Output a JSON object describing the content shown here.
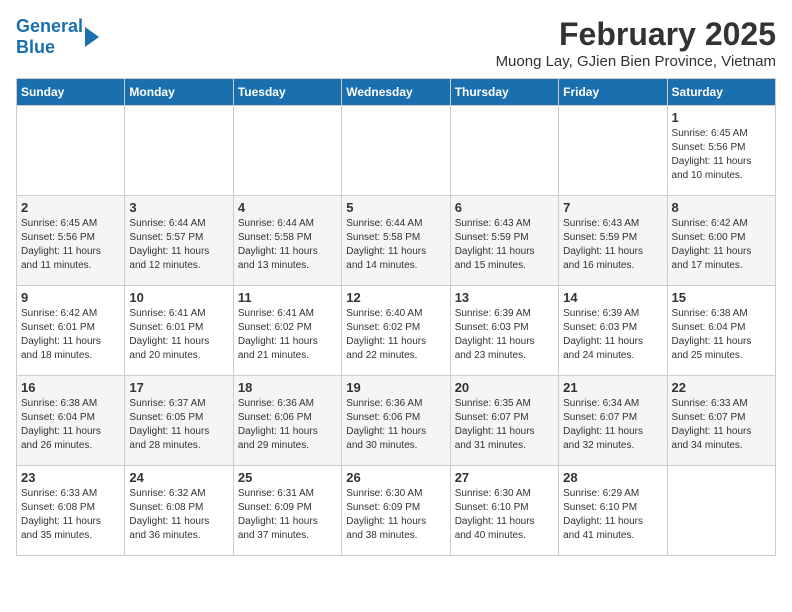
{
  "logo": {
    "line1": "General",
    "line2": "Blue"
  },
  "header": {
    "title": "February 2025",
    "subtitle": "Muong Lay, GJien Bien Province, Vietnam"
  },
  "weekdays": [
    "Sunday",
    "Monday",
    "Tuesday",
    "Wednesday",
    "Thursday",
    "Friday",
    "Saturday"
  ],
  "weeks": [
    [
      {
        "day": "",
        "info": ""
      },
      {
        "day": "",
        "info": ""
      },
      {
        "day": "",
        "info": ""
      },
      {
        "day": "",
        "info": ""
      },
      {
        "day": "",
        "info": ""
      },
      {
        "day": "",
        "info": ""
      },
      {
        "day": "1",
        "info": "Sunrise: 6:45 AM\nSunset: 5:56 PM\nDaylight: 11 hours\nand 10 minutes."
      }
    ],
    [
      {
        "day": "2",
        "info": "Sunrise: 6:45 AM\nSunset: 5:56 PM\nDaylight: 11 hours\nand 11 minutes."
      },
      {
        "day": "3",
        "info": "Sunrise: 6:44 AM\nSunset: 5:57 PM\nDaylight: 11 hours\nand 12 minutes."
      },
      {
        "day": "4",
        "info": "Sunrise: 6:44 AM\nSunset: 5:58 PM\nDaylight: 11 hours\nand 13 minutes."
      },
      {
        "day": "5",
        "info": "Sunrise: 6:44 AM\nSunset: 5:58 PM\nDaylight: 11 hours\nand 14 minutes."
      },
      {
        "day": "6",
        "info": "Sunrise: 6:43 AM\nSunset: 5:59 PM\nDaylight: 11 hours\nand 15 minutes."
      },
      {
        "day": "7",
        "info": "Sunrise: 6:43 AM\nSunset: 5:59 PM\nDaylight: 11 hours\nand 16 minutes."
      },
      {
        "day": "8",
        "info": "Sunrise: 6:42 AM\nSunset: 6:00 PM\nDaylight: 11 hours\nand 17 minutes."
      }
    ],
    [
      {
        "day": "9",
        "info": "Sunrise: 6:42 AM\nSunset: 6:01 PM\nDaylight: 11 hours\nand 18 minutes."
      },
      {
        "day": "10",
        "info": "Sunrise: 6:41 AM\nSunset: 6:01 PM\nDaylight: 11 hours\nand 20 minutes."
      },
      {
        "day": "11",
        "info": "Sunrise: 6:41 AM\nSunset: 6:02 PM\nDaylight: 11 hours\nand 21 minutes."
      },
      {
        "day": "12",
        "info": "Sunrise: 6:40 AM\nSunset: 6:02 PM\nDaylight: 11 hours\nand 22 minutes."
      },
      {
        "day": "13",
        "info": "Sunrise: 6:39 AM\nSunset: 6:03 PM\nDaylight: 11 hours\nand 23 minutes."
      },
      {
        "day": "14",
        "info": "Sunrise: 6:39 AM\nSunset: 6:03 PM\nDaylight: 11 hours\nand 24 minutes."
      },
      {
        "day": "15",
        "info": "Sunrise: 6:38 AM\nSunset: 6:04 PM\nDaylight: 11 hours\nand 25 minutes."
      }
    ],
    [
      {
        "day": "16",
        "info": "Sunrise: 6:38 AM\nSunset: 6:04 PM\nDaylight: 11 hours\nand 26 minutes."
      },
      {
        "day": "17",
        "info": "Sunrise: 6:37 AM\nSunset: 6:05 PM\nDaylight: 11 hours\nand 28 minutes."
      },
      {
        "day": "18",
        "info": "Sunrise: 6:36 AM\nSunset: 6:06 PM\nDaylight: 11 hours\nand 29 minutes."
      },
      {
        "day": "19",
        "info": "Sunrise: 6:36 AM\nSunset: 6:06 PM\nDaylight: 11 hours\nand 30 minutes."
      },
      {
        "day": "20",
        "info": "Sunrise: 6:35 AM\nSunset: 6:07 PM\nDaylight: 11 hours\nand 31 minutes."
      },
      {
        "day": "21",
        "info": "Sunrise: 6:34 AM\nSunset: 6:07 PM\nDaylight: 11 hours\nand 32 minutes."
      },
      {
        "day": "22",
        "info": "Sunrise: 6:33 AM\nSunset: 6:07 PM\nDaylight: 11 hours\nand 34 minutes."
      }
    ],
    [
      {
        "day": "23",
        "info": "Sunrise: 6:33 AM\nSunset: 6:08 PM\nDaylight: 11 hours\nand 35 minutes."
      },
      {
        "day": "24",
        "info": "Sunrise: 6:32 AM\nSunset: 6:08 PM\nDaylight: 11 hours\nand 36 minutes."
      },
      {
        "day": "25",
        "info": "Sunrise: 6:31 AM\nSunset: 6:09 PM\nDaylight: 11 hours\nand 37 minutes."
      },
      {
        "day": "26",
        "info": "Sunrise: 6:30 AM\nSunset: 6:09 PM\nDaylight: 11 hours\nand 38 minutes."
      },
      {
        "day": "27",
        "info": "Sunrise: 6:30 AM\nSunset: 6:10 PM\nDaylight: 11 hours\nand 40 minutes."
      },
      {
        "day": "28",
        "info": "Sunrise: 6:29 AM\nSunset: 6:10 PM\nDaylight: 11 hours\nand 41 minutes."
      },
      {
        "day": "",
        "info": ""
      }
    ]
  ]
}
